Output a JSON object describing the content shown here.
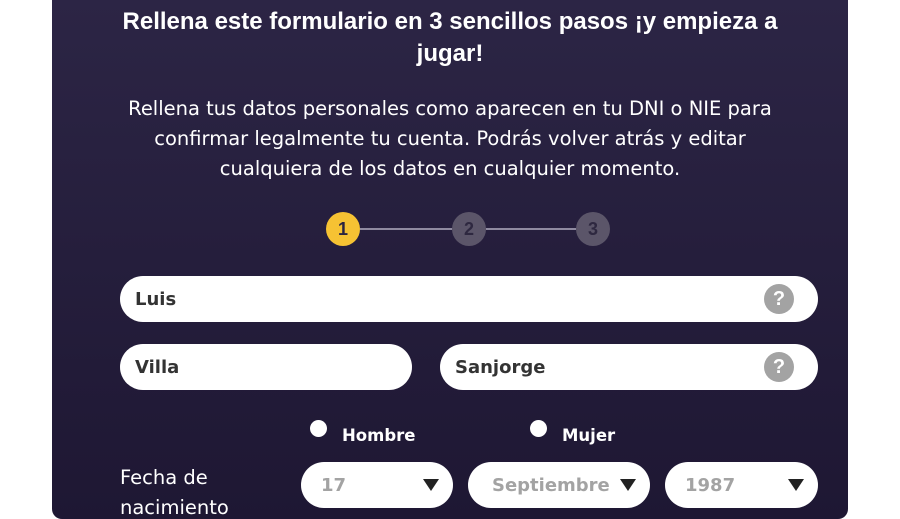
{
  "form": {
    "title": "Rellena este formulario en 3 sencillos pasos ¡y empieza a jugar!",
    "description": "Rellena tus datos personales como aparecen en tu DNI o NIE para confirmar legalmente tu cuenta. Podrás volver atrás y editar cualquiera de los datos en cualquier momento.",
    "steps": [
      {
        "label": "1",
        "active": true
      },
      {
        "label": "2",
        "active": false
      },
      {
        "label": "3",
        "active": false
      }
    ],
    "fields": {
      "first_name": "Luis",
      "surname1": "Villa",
      "surname2": "Sanjorge",
      "help_glyph": "?"
    },
    "gender": {
      "male_label": "Hombre",
      "female_label": "Mujer"
    },
    "dob": {
      "label": "Fecha de nacimiento",
      "day": "17",
      "month": "Septiembre",
      "year": "1987"
    }
  },
  "colors": {
    "panel_bg": "#2c2545",
    "active_step": "#f6c233",
    "inactive_step": "#5b5569",
    "help_icon": "#a3a3a3"
  },
  "icons": [
    "help-icon",
    "dropdown-caret-icon"
  ]
}
